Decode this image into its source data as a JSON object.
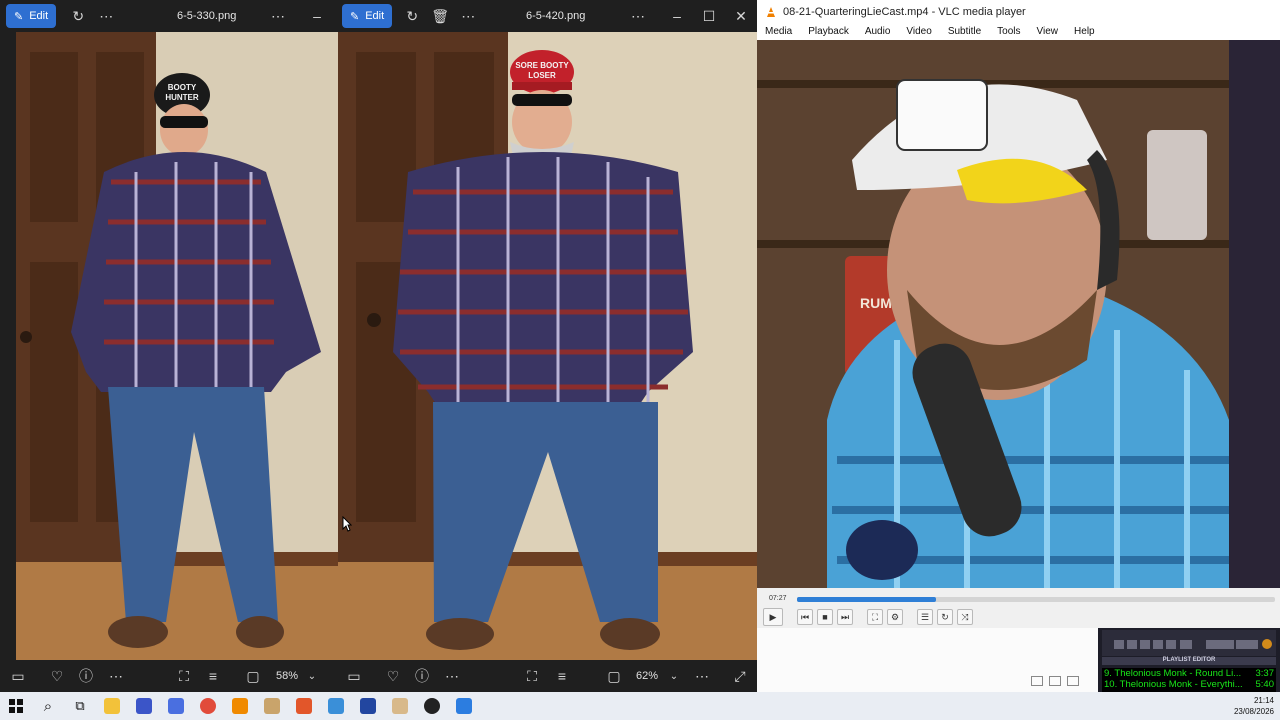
{
  "left_viewer": {
    "edit_label": "Edit",
    "filename": "6-5-330.png",
    "hat_text_line1": "BOOTY",
    "hat_text_line2": "HUNTER",
    "zoom": "58%"
  },
  "right_viewer": {
    "edit_label": "Edit",
    "filename": "6-5-420.png",
    "hat_text_line1": "SORE BOOTY",
    "hat_text_line2": "LOSER",
    "zoom": "62%"
  },
  "vlc": {
    "title": "08-21-QuarteringLieCast.mp4 - VLC media player",
    "menu": [
      "Media",
      "Playback",
      "Audio",
      "Video",
      "Subtitle",
      "Tools",
      "View",
      "Help"
    ],
    "elapsed": "07:27",
    "progress_fraction": 0.29,
    "poster_text": "RUM"
  },
  "winamp": {
    "playlist_title": "PLAYLIST EDITOR",
    "tracks": [
      {
        "label": "9. Thelonious Monk - Round Li...",
        "time": "3:37"
      },
      {
        "label": "10. Thelonious Monk - Everythi...",
        "time": "5:40"
      }
    ]
  },
  "taskbar": {
    "time": "21:14",
    "date": "23/08/2026"
  },
  "colors": {
    "accent": "#2e6fd1",
    "vlc_progress": "#2f7fd6",
    "winamp_text": "#19e619"
  }
}
